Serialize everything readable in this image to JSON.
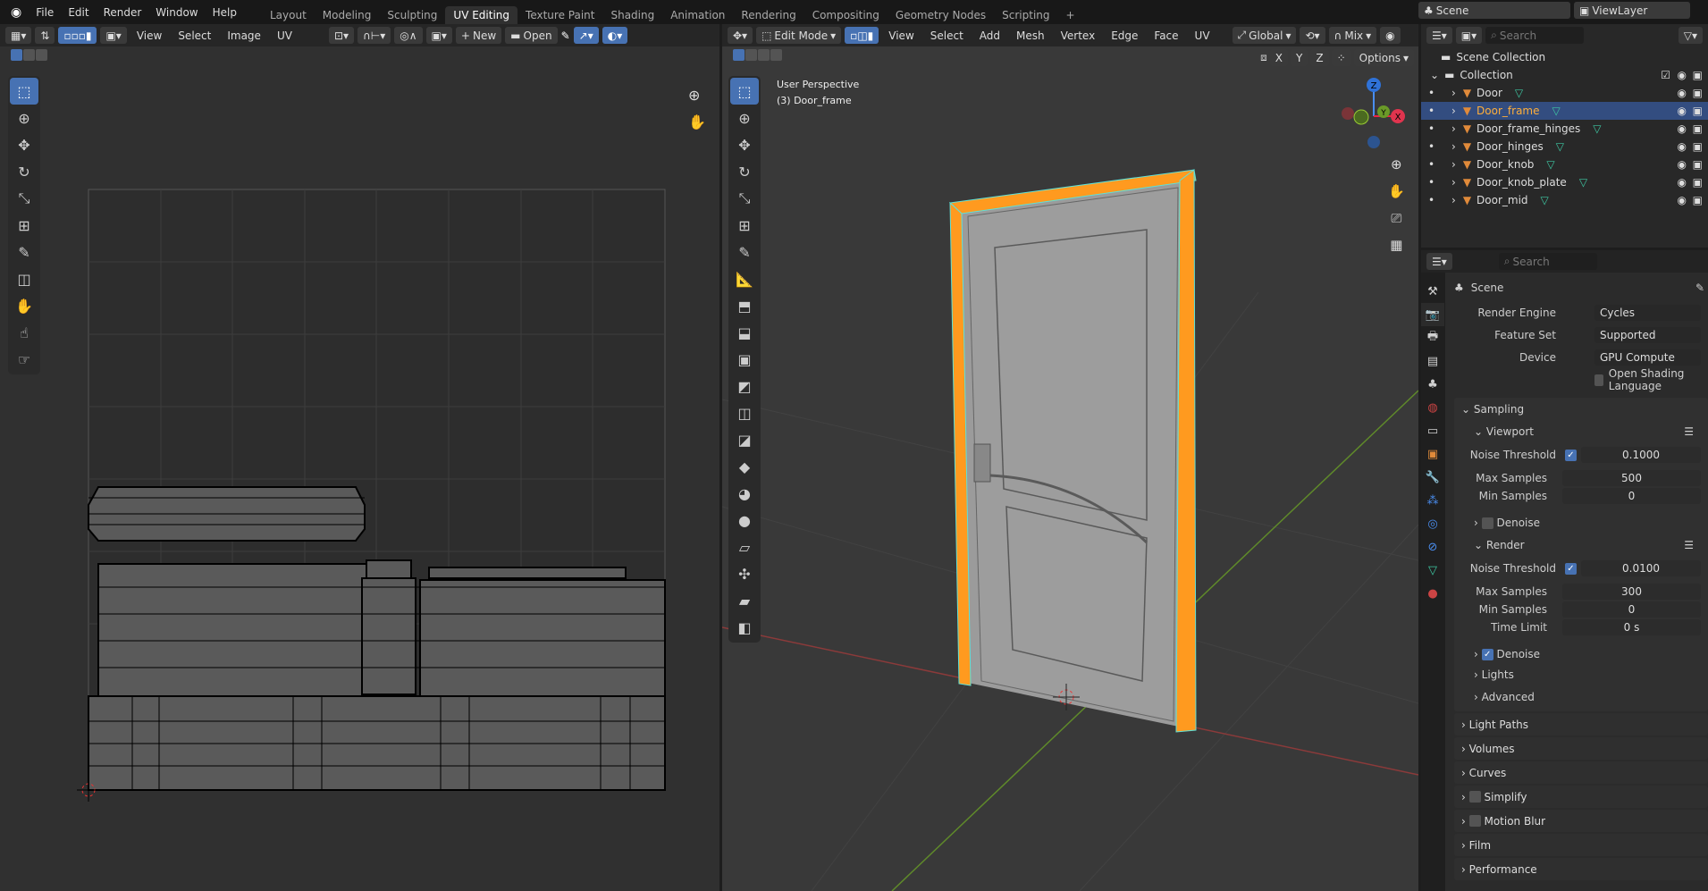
{
  "topbar": {
    "menus": [
      "File",
      "Edit",
      "Render",
      "Window",
      "Help"
    ],
    "workspaces": [
      "Layout",
      "Modeling",
      "Sculpting",
      "UV Editing",
      "Texture Paint",
      "Shading",
      "Animation",
      "Rendering",
      "Compositing",
      "Geometry Nodes",
      "Scripting"
    ],
    "active_workspace": "UV Editing",
    "add_tab": "+",
    "scene": "Scene",
    "view_layer": "ViewLayer"
  },
  "uv_editor": {
    "menus": [
      "View",
      "Select",
      "Image",
      "UV"
    ],
    "new_label": "New",
    "open_label": "Open"
  },
  "viewport": {
    "mode": "Edit Mode",
    "menus": [
      "View",
      "Select",
      "Add",
      "Mesh",
      "Vertex",
      "Edge",
      "Face",
      "UV"
    ],
    "orientation": "Global",
    "proportional": "Mix",
    "axes": [
      "X",
      "Y",
      "Z"
    ],
    "options_label": "Options",
    "perspective": "User Perspective",
    "object_info": "(3) Door_frame",
    "gizmo": {
      "z": "Z",
      "y": "Y",
      "x": "X"
    }
  },
  "outliner": {
    "search_placeholder": "Search",
    "scene_collection": "Scene Collection",
    "collection": "Collection",
    "objects": [
      {
        "name": "Door",
        "selected": false
      },
      {
        "name": "Door_frame",
        "selected": true
      },
      {
        "name": "Door_frame_hinges",
        "selected": false
      },
      {
        "name": "Door_hinges",
        "selected": false
      },
      {
        "name": "Door_knob",
        "selected": false
      },
      {
        "name": "Door_knob_plate",
        "selected": false
      },
      {
        "name": "Door_mid",
        "selected": false
      }
    ]
  },
  "properties": {
    "search_placeholder": "Search",
    "context": "Scene",
    "render_engine": {
      "label": "Render Engine",
      "value": "Cycles"
    },
    "feature_set": {
      "label": "Feature Set",
      "value": "Supported"
    },
    "device": {
      "label": "Device",
      "value": "GPU Compute"
    },
    "osl": {
      "label": "Open Shading Language",
      "checked": false
    },
    "sampling": "Sampling",
    "viewport": "Viewport",
    "vp_noise": {
      "label": "Noise Threshold",
      "value": "0.1000",
      "checked": true
    },
    "vp_max": {
      "label": "Max Samples",
      "value": "500"
    },
    "vp_min": {
      "label": "Min Samples",
      "value": "0"
    },
    "vp_denoise": {
      "label": "Denoise",
      "checked": false
    },
    "render": "Render",
    "r_noise": {
      "label": "Noise Threshold",
      "value": "0.0100",
      "checked": true
    },
    "r_max": {
      "label": "Max Samples",
      "value": "300"
    },
    "r_min": {
      "label": "Min Samples",
      "value": "0"
    },
    "r_time": {
      "label": "Time Limit",
      "value": "0 s"
    },
    "r_denoise": {
      "label": "Denoise",
      "checked": true
    },
    "lights": "Lights",
    "advanced": "Advanced",
    "panels": [
      "Light Paths",
      "Volumes",
      "Curves",
      "Simplify",
      "Motion Blur",
      "Film",
      "Performance"
    ]
  },
  "colors": {
    "accent": "#4772b3",
    "selected_orange": "#ff9a1f",
    "mesh_teal": "#3ec7a2"
  }
}
